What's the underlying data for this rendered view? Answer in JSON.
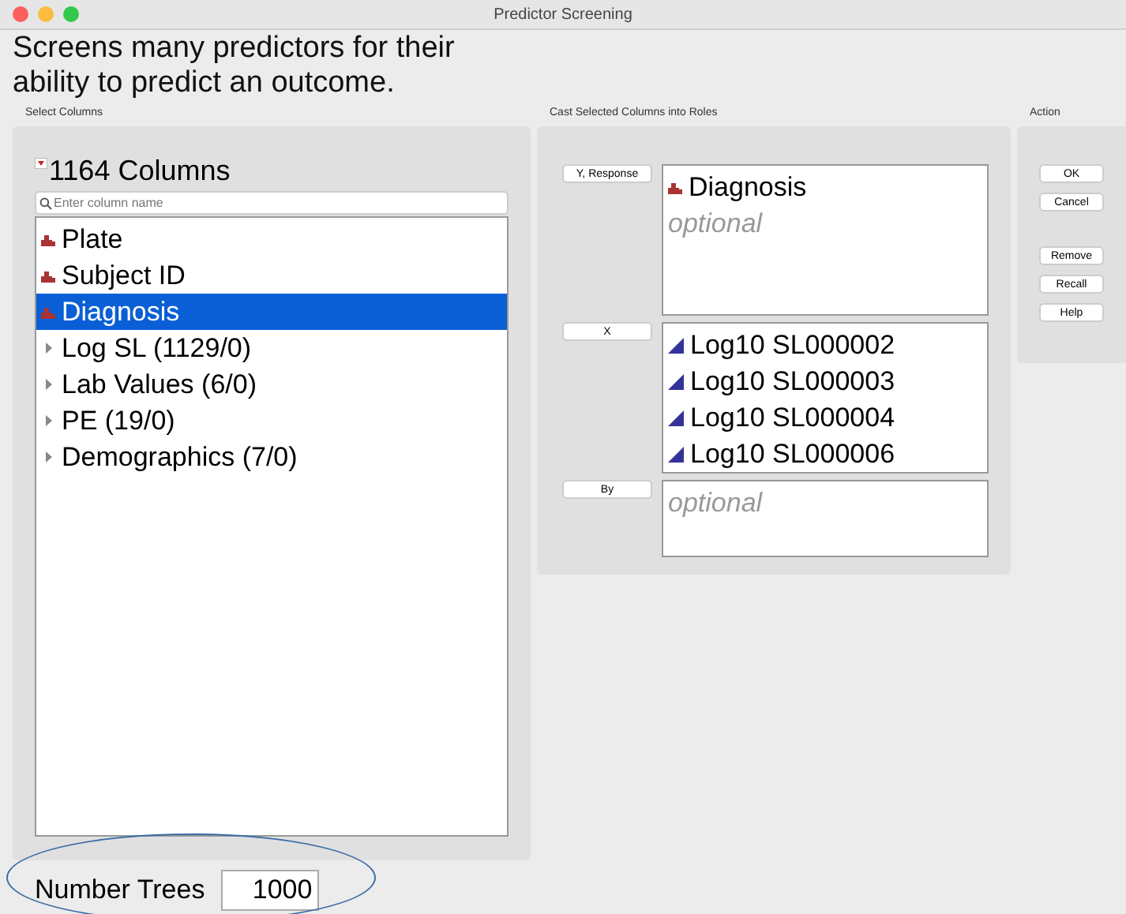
{
  "window": {
    "title": "Predictor Screening"
  },
  "description": "Screens many predictors for their ability to predict an outcome.",
  "select_columns": {
    "label": "Select Columns",
    "count": "1164 Columns",
    "search": {
      "placeholder": "Enter column name"
    },
    "items": [
      {
        "label": "Plate",
        "kind": "nominal",
        "selected": false
      },
      {
        "label": "Subject ID",
        "kind": "nominal",
        "selected": false
      },
      {
        "label": "Diagnosis",
        "kind": "nominal",
        "selected": true
      },
      {
        "label": "Log SL  (1129/0)",
        "kind": "group",
        "selected": false
      },
      {
        "label": "Lab Values (6/0)",
        "kind": "group",
        "selected": false
      },
      {
        "label": "PE (19/0)",
        "kind": "group",
        "selected": false
      },
      {
        "label": "Demographics (7/0)",
        "kind": "group",
        "selected": false
      }
    ]
  },
  "roles": {
    "label": "Cast Selected Columns into Roles",
    "rows": [
      {
        "button": "Y, Response",
        "items": [
          {
            "label": "Diagnosis",
            "kind": "nominal"
          }
        ],
        "placeholder": "optional"
      },
      {
        "button": "X",
        "items": [
          {
            "label": "Log10 SL000002",
            "kind": "continuous"
          },
          {
            "label": "Log10 SL000003",
            "kind": "continuous"
          },
          {
            "label": "Log10 SL000004",
            "kind": "continuous"
          },
          {
            "label": "Log10 SL000006",
            "kind": "continuous"
          }
        ]
      },
      {
        "button": "By",
        "items": [],
        "placeholder": "optional"
      }
    ]
  },
  "action": {
    "label": "Action",
    "buttons": [
      "OK",
      "Cancel",
      "Remove",
      "Recall",
      "Help"
    ]
  },
  "number_trees": {
    "label": "Number Trees",
    "value": "1000"
  }
}
